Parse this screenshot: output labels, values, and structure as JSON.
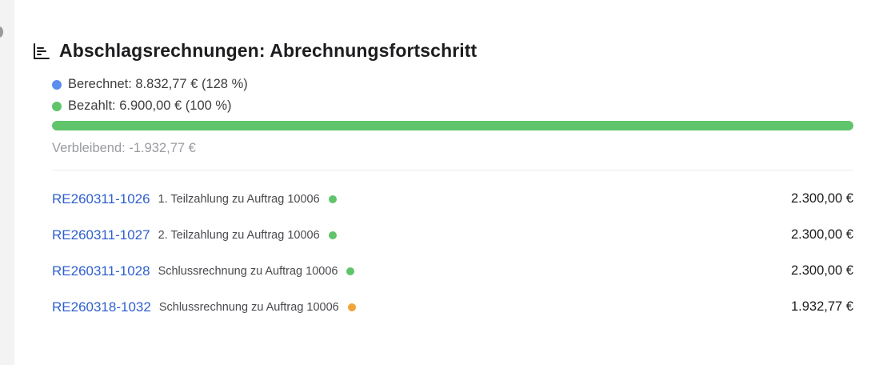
{
  "header": {
    "title": "Abschlagsrechnungen: Abrechnungsfortschritt",
    "icon": "bar-chart-icon"
  },
  "legend": {
    "calculated": {
      "label": "Berechnet: 8.832,77 € (128 %)",
      "color": "#5b8def"
    },
    "paid": {
      "label": "Bezahlt: 6.900,00 € (100 %)",
      "color": "#5fc46a"
    }
  },
  "progress": {
    "paid_fraction": 1.0,
    "fill_color": "#5fc46a"
  },
  "remaining": {
    "label": "Verbleibend: -1.932,77 €"
  },
  "invoices": [
    {
      "id": "RE260311-1026",
      "description": "1. Teilzahlung zu Auftrag 10006",
      "status_color": "#5fc46a",
      "amount": "2.300,00 €"
    },
    {
      "id": "RE260311-1027",
      "description": "2. Teilzahlung zu Auftrag 10006",
      "status_color": "#5fc46a",
      "amount": "2.300,00 €"
    },
    {
      "id": "RE260311-1028",
      "description": "Schlussrechnung zu Auftrag 10006",
      "status_color": "#5fc46a",
      "amount": "2.300,00 €"
    },
    {
      "id": "RE260318-1032",
      "description": "Schlussrechnung zu Auftrag 10006",
      "status_color": "#f0a43a",
      "amount": "1.932,77 €"
    }
  ]
}
